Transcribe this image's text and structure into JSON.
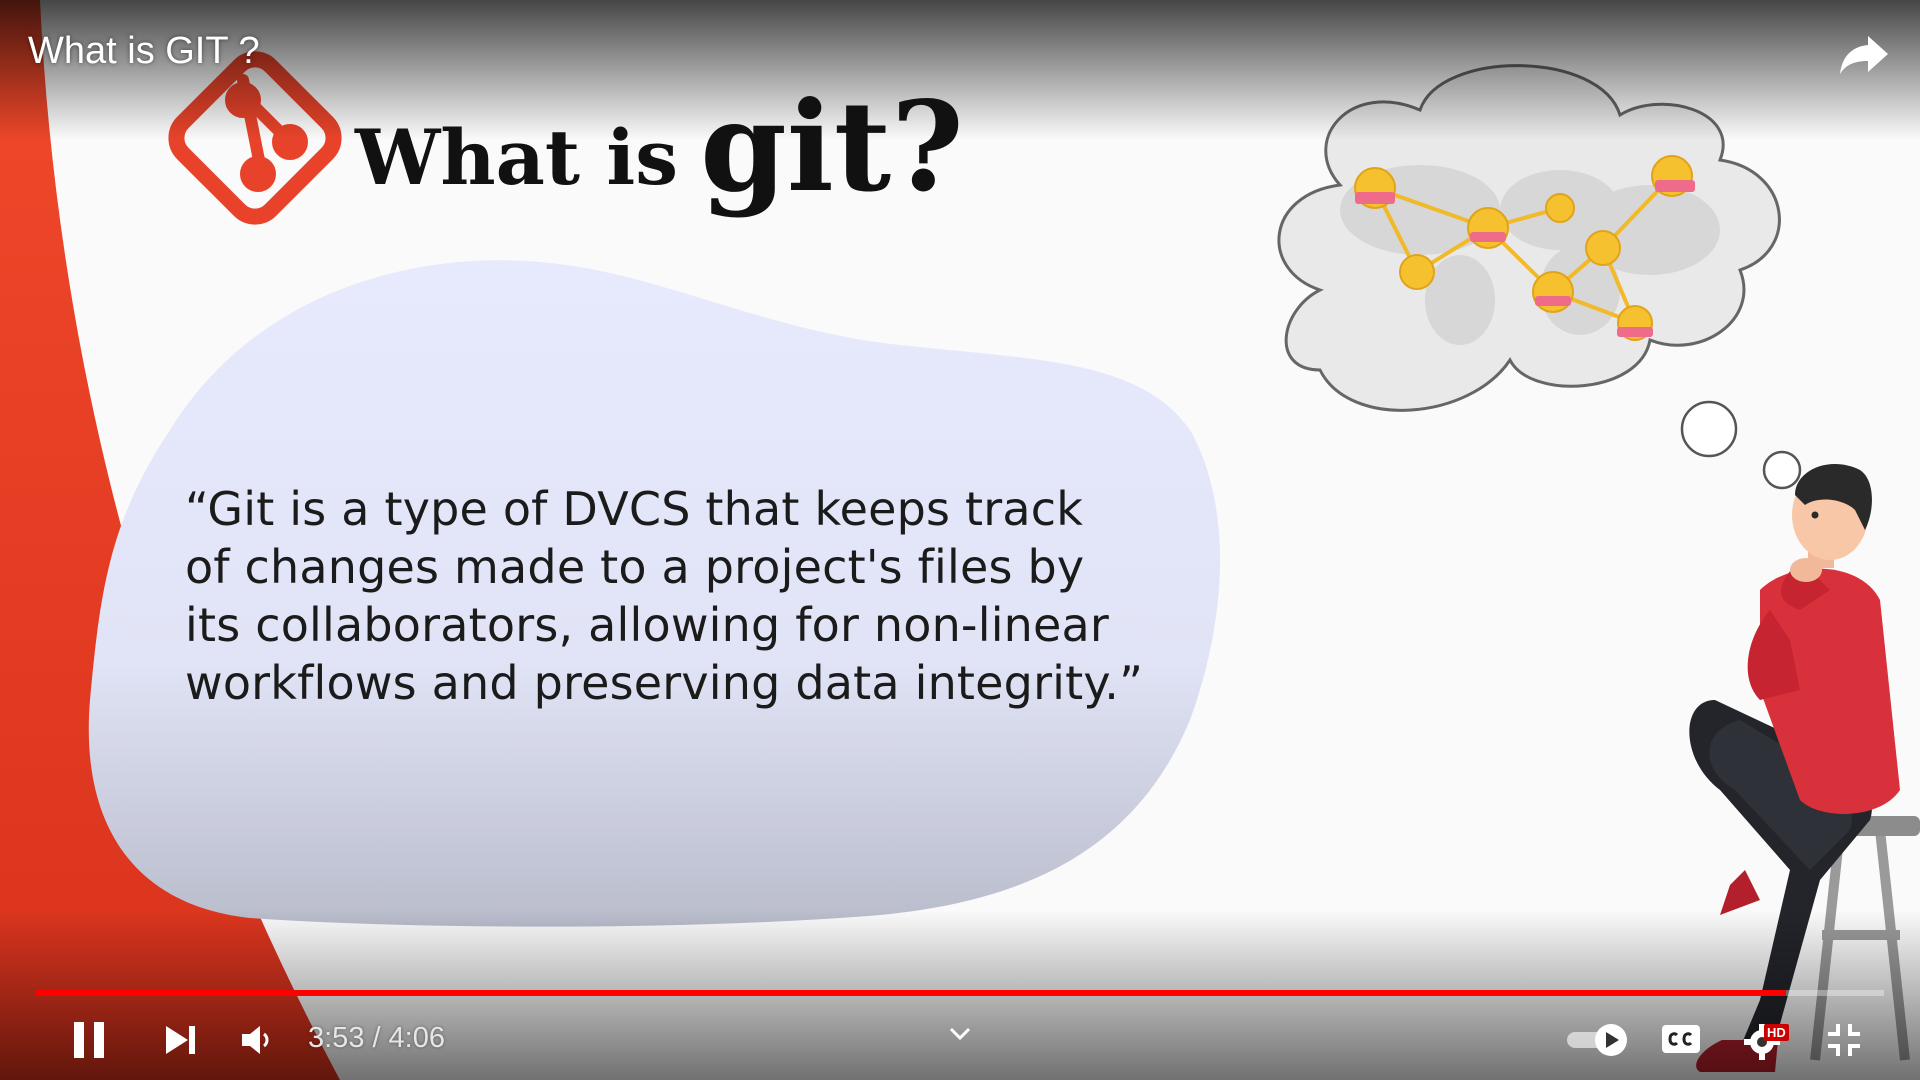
{
  "player": {
    "video_title": "What is GIT ?",
    "current_time": "3:53",
    "duration": "4:06",
    "progress_fraction": 0.947,
    "time_separator": "/",
    "hd_badge": "HD",
    "accent_color": "#ff0000",
    "controls": {
      "pause": "pause-icon",
      "next": "skip-next-icon",
      "volume": "volume-icon",
      "chapters": "chevron-down-icon",
      "autoplay": "autoplay-toggle-icon",
      "captions": "cc-icon",
      "settings": "gear-icon",
      "fullscreen_exit": "exit-fullscreen-icon",
      "share": "share-arrow-icon"
    }
  },
  "slide": {
    "heading_prefix": "What is",
    "heading_main": "git?",
    "logo": "git-logo-icon",
    "quote_lines": [
      "“Git is a type of DVCS that keeps track",
      "of changes made to a project's files by",
      "its collaborators, allowing for non-linear",
      "workflows and preserving data integrity.”"
    ],
    "brand_color": "#e8432a",
    "blob_color": "#e4e8fb"
  }
}
